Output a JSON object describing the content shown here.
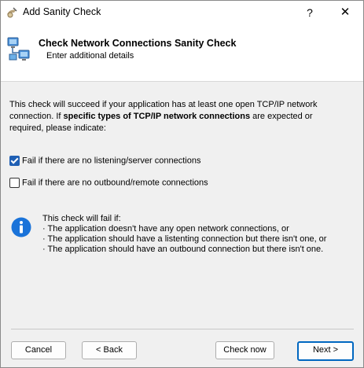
{
  "window": {
    "title": "Add Sanity Check",
    "help_glyph": "?",
    "close_glyph": "✕"
  },
  "header": {
    "title": "Check Network Connections Sanity Check",
    "subtitle": "Enter additional details",
    "icon": "network-computers-icon"
  },
  "description": {
    "part1": "This check will succeed if your application has at least one open TCP/IP network connection. If ",
    "bold": "specific types of TCP/IP network connections",
    "part2": " are expected or required, please indicate:"
  },
  "options": [
    {
      "label": "Fail if there are no listening/server connections",
      "checked": true
    },
    {
      "label": "Fail if there are no outbound/remote connections",
      "checked": false
    }
  ],
  "info": {
    "icon": "info-icon",
    "heading": "This check will fail if:",
    "items": [
      "· The application doesn't have any open network connections, or",
      "· The application should have a listenting connection but there isn't one, or",
      "· The application should have an outbound connection but there isn't one."
    ]
  },
  "buttons": {
    "cancel": "Cancel",
    "back": "< Back",
    "check_now": "Check now",
    "next": "Next >"
  },
  "colors": {
    "accent": "#0067c0",
    "checkbox_checked": "#1f5fb4"
  }
}
